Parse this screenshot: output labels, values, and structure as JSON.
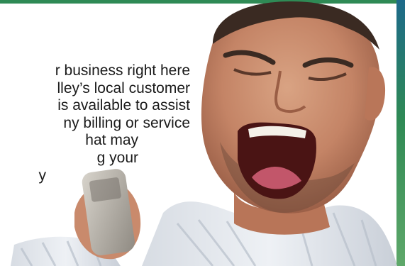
{
  "ad": {
    "body_lines": [
      "r business right here",
      "lley’s local customer",
      "is available to assist",
      "ny billing or service",
      "hat may",
      "g your",
      "y"
    ]
  },
  "colors": {
    "accent_green": "#2f8a55",
    "accent_blue": "#1d6a8a"
  },
  "icons": {
    "phone": "mobile-phone-icon"
  }
}
